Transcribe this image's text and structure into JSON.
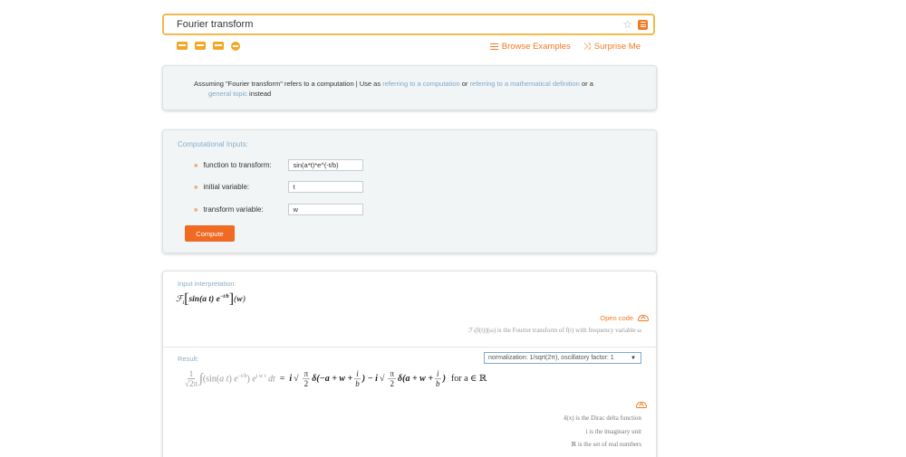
{
  "search": {
    "query": "Fourier transform"
  },
  "header_links": {
    "browse": "Browse Examples",
    "surprise": "Surprise Me"
  },
  "assumption": {
    "prefix": "Assuming \"Fourier transform\" refers to a computation | Use as",
    "opt1": "referring to a computation",
    "or1": "or",
    "opt2": "referring to a mathematical definition",
    "or2": "or a",
    "opt3": "general topic",
    "suffix": "instead"
  },
  "computational_inputs": {
    "title": "Computational Inputs:",
    "fields": [
      {
        "label": "function to transform:",
        "value": "sin(a*t)*e^(-t/b)"
      },
      {
        "label": "initial variable:",
        "value": "t"
      },
      {
        "label": "transform variable:",
        "value": "w"
      }
    ],
    "compute_label": "Compute"
  },
  "interpretation": {
    "title": "Input interpretation:",
    "open_code": "Open code",
    "note": "ℱₜ[f(t)](ω) is the Fourier transform of f(t) with frequency variable ω"
  },
  "result": {
    "title": "Result:",
    "normalization": "normalization: 1/sqrt(2π), oscillatory factor: 1",
    "condition": "for a ∈ ℝ",
    "notes": [
      "δ(x) is the Dirac delta function",
      "i is the imaginary unit",
      "ℝ is the set of real numbers"
    ]
  }
}
